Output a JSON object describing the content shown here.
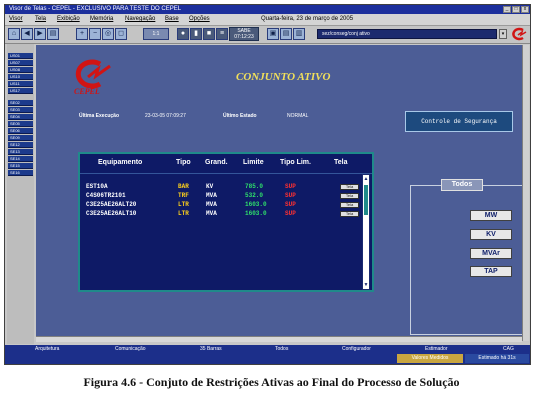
{
  "window": {
    "title": "Visor de Telas - CEPEL - EXCLUSIVO PARA TESTE DO CEPEL",
    "controls": [
      "_",
      "□",
      "x"
    ]
  },
  "menubar": {
    "items": [
      "Visor",
      "Tela",
      "Exibição",
      "Memória",
      "Navegação",
      "Base",
      "Opções"
    ],
    "datetime": "Quarta-feira, 23 de março de 2005"
  },
  "toolbar": {
    "zoom_value": "1:1",
    "sabe_label": "SABE",
    "sabe_time": "07:12:23",
    "path": "sez/conseg/conj ativo",
    "icons": [
      "home-icon",
      "back-icon",
      "forward-icon",
      "print-icon",
      "zoom-in-icon",
      "zoom-out-icon",
      "zoom-fit-icon",
      "zoom-area-icon",
      "record-icon",
      "pause-icon",
      "stop-icon",
      "list-icon",
      "window-a-icon",
      "window-b-icon",
      "window-c-icon"
    ]
  },
  "sidebar": {
    "items": [
      "US01",
      "US07",
      "US08",
      "US10",
      "US11",
      "US17",
      "SE02",
      "SE03",
      "SE04",
      "SE05",
      "SE06",
      "SE09",
      "SE12",
      "SE13",
      "SE14",
      "SE15",
      "SE16"
    ]
  },
  "main": {
    "cepel_text": "CEPEL",
    "page_title": "CONJUNTO ATIVO",
    "last_exec_label": "Última Execução",
    "last_exec_value": "23-03-05 07:09:27",
    "last_state_label": "Último Estado",
    "last_state_value": "NORMAL",
    "security_button": "Controle de Segurança",
    "table": {
      "headers": [
        "Equipamento",
        "Tipo",
        "Grand.",
        "Limite",
        "Tipo Lim.",
        "Tela"
      ],
      "rows": [
        {
          "equip": "EST10A",
          "tipo": "BAR",
          "grand": "KV",
          "limite": "785.0",
          "tipo_lim": "SUP",
          "tela": "Tela"
        },
        {
          "equip": "C4S06TR2101",
          "tipo": "TRF",
          "grand": "MVA",
          "limite": "532.0",
          "tipo_lim": "SUP",
          "tela": "Tela"
        },
        {
          "equip": "C3E25AE26ALT20",
          "tipo": "LTR",
          "grand": "MVA",
          "limite": "1603.0",
          "tipo_lim": "SUP",
          "tela": "Tela"
        },
        {
          "equip": "C3E25AE26ALT10",
          "tipo": "LTR",
          "grand": "MVA",
          "limite": "1603.0",
          "tipo_lim": "SUP",
          "tela": "Tela"
        }
      ]
    },
    "todos": {
      "label": "Todos",
      "buttons": [
        "MW",
        "KV",
        "MVAr",
        "TAP"
      ]
    }
  },
  "bottombar": {
    "items": [
      "Arquitetura",
      "Comunicação",
      "35 Barras",
      "Todos",
      "Configurador",
      "Estimador",
      "CAG"
    ]
  },
  "statusbar": {
    "valores_medidos": "Valores Medidos",
    "estado": "Estimado há 31s"
  },
  "caption": "Figura 4.6 - Conjuto de Restrições Ativas ao Final do Processo de Solução",
  "colors": {
    "title_bar": "#1c2f9c",
    "main_bg": "#4c5d96",
    "table_bg": "#0e1a66",
    "title_yellow": "#f2e05a",
    "logo_red": "#d11414",
    "limit_green": "#2fe06a",
    "tipo_yellow": "#ffd21a",
    "sup_red": "#ff3030"
  }
}
